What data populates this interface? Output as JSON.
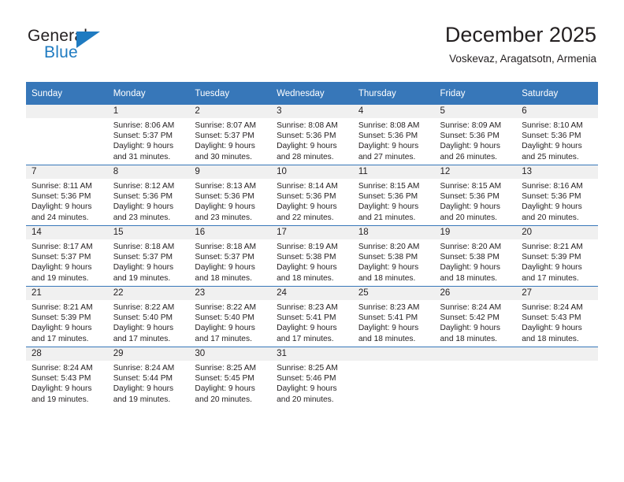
{
  "brand": {
    "name_part1": "General",
    "name_part2": "Blue",
    "triangle_color": "#1f7bc1",
    "text_color": "#231f20"
  },
  "header": {
    "title": "December 2025",
    "subtitle": "Voskevaz, Aragatsotn, Armenia",
    "header_bg": "#3777b9",
    "header_text_color": "#ffffff"
  },
  "weekday_headers": [
    "Sunday",
    "Monday",
    "Tuesday",
    "Wednesday",
    "Thursday",
    "Friday",
    "Saturday"
  ],
  "weeks": [
    [
      {
        "day": "",
        "sunrise": "",
        "sunset": "",
        "daylight_line1": "",
        "daylight_line2": "",
        "blank": true
      },
      {
        "day": "1",
        "sunrise": "Sunrise: 8:06 AM",
        "sunset": "Sunset: 5:37 PM",
        "daylight_line1": "Daylight: 9 hours",
        "daylight_line2": "and 31 minutes.",
        "blank": false
      },
      {
        "day": "2",
        "sunrise": "Sunrise: 8:07 AM",
        "sunset": "Sunset: 5:37 PM",
        "daylight_line1": "Daylight: 9 hours",
        "daylight_line2": "and 30 minutes.",
        "blank": false
      },
      {
        "day": "3",
        "sunrise": "Sunrise: 8:08 AM",
        "sunset": "Sunset: 5:36 PM",
        "daylight_line1": "Daylight: 9 hours",
        "daylight_line2": "and 28 minutes.",
        "blank": false
      },
      {
        "day": "4",
        "sunrise": "Sunrise: 8:08 AM",
        "sunset": "Sunset: 5:36 PM",
        "daylight_line1": "Daylight: 9 hours",
        "daylight_line2": "and 27 minutes.",
        "blank": false
      },
      {
        "day": "5",
        "sunrise": "Sunrise: 8:09 AM",
        "sunset": "Sunset: 5:36 PM",
        "daylight_line1": "Daylight: 9 hours",
        "daylight_line2": "and 26 minutes.",
        "blank": false
      },
      {
        "day": "6",
        "sunrise": "Sunrise: 8:10 AM",
        "sunset": "Sunset: 5:36 PM",
        "daylight_line1": "Daylight: 9 hours",
        "daylight_line2": "and 25 minutes.",
        "blank": false
      }
    ],
    [
      {
        "day": "7",
        "sunrise": "Sunrise: 8:11 AM",
        "sunset": "Sunset: 5:36 PM",
        "daylight_line1": "Daylight: 9 hours",
        "daylight_line2": "and 24 minutes.",
        "blank": false
      },
      {
        "day": "8",
        "sunrise": "Sunrise: 8:12 AM",
        "sunset": "Sunset: 5:36 PM",
        "daylight_line1": "Daylight: 9 hours",
        "daylight_line2": "and 23 minutes.",
        "blank": false
      },
      {
        "day": "9",
        "sunrise": "Sunrise: 8:13 AM",
        "sunset": "Sunset: 5:36 PM",
        "daylight_line1": "Daylight: 9 hours",
        "daylight_line2": "and 23 minutes.",
        "blank": false
      },
      {
        "day": "10",
        "sunrise": "Sunrise: 8:14 AM",
        "sunset": "Sunset: 5:36 PM",
        "daylight_line1": "Daylight: 9 hours",
        "daylight_line2": "and 22 minutes.",
        "blank": false
      },
      {
        "day": "11",
        "sunrise": "Sunrise: 8:15 AM",
        "sunset": "Sunset: 5:36 PM",
        "daylight_line1": "Daylight: 9 hours",
        "daylight_line2": "and 21 minutes.",
        "blank": false
      },
      {
        "day": "12",
        "sunrise": "Sunrise: 8:15 AM",
        "sunset": "Sunset: 5:36 PM",
        "daylight_line1": "Daylight: 9 hours",
        "daylight_line2": "and 20 minutes.",
        "blank": false
      },
      {
        "day": "13",
        "sunrise": "Sunrise: 8:16 AM",
        "sunset": "Sunset: 5:36 PM",
        "daylight_line1": "Daylight: 9 hours",
        "daylight_line2": "and 20 minutes.",
        "blank": false
      }
    ],
    [
      {
        "day": "14",
        "sunrise": "Sunrise: 8:17 AM",
        "sunset": "Sunset: 5:37 PM",
        "daylight_line1": "Daylight: 9 hours",
        "daylight_line2": "and 19 minutes.",
        "blank": false
      },
      {
        "day": "15",
        "sunrise": "Sunrise: 8:18 AM",
        "sunset": "Sunset: 5:37 PM",
        "daylight_line1": "Daylight: 9 hours",
        "daylight_line2": "and 19 minutes.",
        "blank": false
      },
      {
        "day": "16",
        "sunrise": "Sunrise: 8:18 AM",
        "sunset": "Sunset: 5:37 PM",
        "daylight_line1": "Daylight: 9 hours",
        "daylight_line2": "and 18 minutes.",
        "blank": false
      },
      {
        "day": "17",
        "sunrise": "Sunrise: 8:19 AM",
        "sunset": "Sunset: 5:38 PM",
        "daylight_line1": "Daylight: 9 hours",
        "daylight_line2": "and 18 minutes.",
        "blank": false
      },
      {
        "day": "18",
        "sunrise": "Sunrise: 8:20 AM",
        "sunset": "Sunset: 5:38 PM",
        "daylight_line1": "Daylight: 9 hours",
        "daylight_line2": "and 18 minutes.",
        "blank": false
      },
      {
        "day": "19",
        "sunrise": "Sunrise: 8:20 AM",
        "sunset": "Sunset: 5:38 PM",
        "daylight_line1": "Daylight: 9 hours",
        "daylight_line2": "and 18 minutes.",
        "blank": false
      },
      {
        "day": "20",
        "sunrise": "Sunrise: 8:21 AM",
        "sunset": "Sunset: 5:39 PM",
        "daylight_line1": "Daylight: 9 hours",
        "daylight_line2": "and 17 minutes.",
        "blank": false
      }
    ],
    [
      {
        "day": "21",
        "sunrise": "Sunrise: 8:21 AM",
        "sunset": "Sunset: 5:39 PM",
        "daylight_line1": "Daylight: 9 hours",
        "daylight_line2": "and 17 minutes.",
        "blank": false
      },
      {
        "day": "22",
        "sunrise": "Sunrise: 8:22 AM",
        "sunset": "Sunset: 5:40 PM",
        "daylight_line1": "Daylight: 9 hours",
        "daylight_line2": "and 17 minutes.",
        "blank": false
      },
      {
        "day": "23",
        "sunrise": "Sunrise: 8:22 AM",
        "sunset": "Sunset: 5:40 PM",
        "daylight_line1": "Daylight: 9 hours",
        "daylight_line2": "and 17 minutes.",
        "blank": false
      },
      {
        "day": "24",
        "sunrise": "Sunrise: 8:23 AM",
        "sunset": "Sunset: 5:41 PM",
        "daylight_line1": "Daylight: 9 hours",
        "daylight_line2": "and 17 minutes.",
        "blank": false
      },
      {
        "day": "25",
        "sunrise": "Sunrise: 8:23 AM",
        "sunset": "Sunset: 5:41 PM",
        "daylight_line1": "Daylight: 9 hours",
        "daylight_line2": "and 18 minutes.",
        "blank": false
      },
      {
        "day": "26",
        "sunrise": "Sunrise: 8:24 AM",
        "sunset": "Sunset: 5:42 PM",
        "daylight_line1": "Daylight: 9 hours",
        "daylight_line2": "and 18 minutes.",
        "blank": false
      },
      {
        "day": "27",
        "sunrise": "Sunrise: 8:24 AM",
        "sunset": "Sunset: 5:43 PM",
        "daylight_line1": "Daylight: 9 hours",
        "daylight_line2": "and 18 minutes.",
        "blank": false
      }
    ],
    [
      {
        "day": "28",
        "sunrise": "Sunrise: 8:24 AM",
        "sunset": "Sunset: 5:43 PM",
        "daylight_line1": "Daylight: 9 hours",
        "daylight_line2": "and 19 minutes.",
        "blank": false
      },
      {
        "day": "29",
        "sunrise": "Sunrise: 8:24 AM",
        "sunset": "Sunset: 5:44 PM",
        "daylight_line1": "Daylight: 9 hours",
        "daylight_line2": "and 19 minutes.",
        "blank": false
      },
      {
        "day": "30",
        "sunrise": "Sunrise: 8:25 AM",
        "sunset": "Sunset: 5:45 PM",
        "daylight_line1": "Daylight: 9 hours",
        "daylight_line2": "and 20 minutes.",
        "blank": false
      },
      {
        "day": "31",
        "sunrise": "Sunrise: 8:25 AM",
        "sunset": "Sunset: 5:46 PM",
        "daylight_line1": "Daylight: 9 hours",
        "daylight_line2": "and 20 minutes.",
        "blank": false
      },
      {
        "day": "",
        "sunrise": "",
        "sunset": "",
        "daylight_line1": "",
        "daylight_line2": "",
        "blank": true
      },
      {
        "day": "",
        "sunrise": "",
        "sunset": "",
        "daylight_line1": "",
        "daylight_line2": "",
        "blank": true
      },
      {
        "day": "",
        "sunrise": "",
        "sunset": "",
        "daylight_line1": "",
        "daylight_line2": "",
        "blank": true
      }
    ]
  ]
}
